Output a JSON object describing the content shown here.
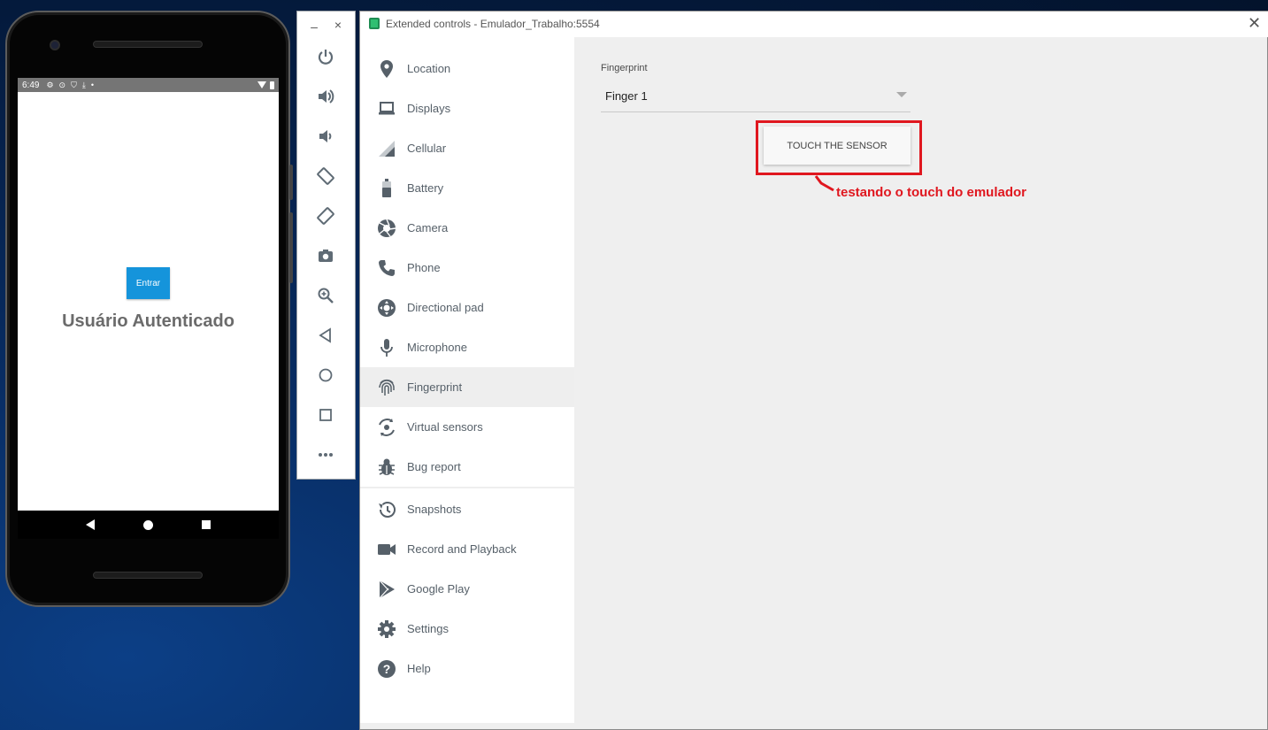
{
  "phone": {
    "status": {
      "time": "6:49",
      "icons": [
        "settings-icon",
        "location-icon",
        "shield-icon",
        "download-icon",
        "dot-icon"
      ],
      "right_icons": [
        "wifi-icon",
        "battery-icon"
      ]
    },
    "button_label": "Entrar",
    "auth_text": "Usuário Autenticado",
    "nav": [
      "back",
      "home",
      "recents"
    ]
  },
  "toolbar": {
    "minimize": "–",
    "close": "×",
    "buttons": [
      "power",
      "volume-up",
      "volume-down",
      "rotate-left",
      "rotate-right",
      "screenshot",
      "zoom",
      "back",
      "home",
      "overview",
      "more"
    ]
  },
  "window": {
    "title": "Extended controls - Emulador_Trabalho:5554",
    "close": "✕"
  },
  "sidebar": {
    "items": [
      {
        "label": "Location",
        "icon": "location-icon"
      },
      {
        "label": "Displays",
        "icon": "displays-icon"
      },
      {
        "label": "Cellular",
        "icon": "cellular-icon"
      },
      {
        "label": "Battery",
        "icon": "battery-icon"
      },
      {
        "label": "Camera",
        "icon": "camera-icon"
      },
      {
        "label": "Phone",
        "icon": "phone-icon"
      },
      {
        "label": "Directional pad",
        "icon": "dpad-icon"
      },
      {
        "label": "Microphone",
        "icon": "microphone-icon"
      },
      {
        "label": "Fingerprint",
        "icon": "fingerprint-icon",
        "active": true
      },
      {
        "label": "Virtual sensors",
        "icon": "virtual-sensors-icon"
      },
      {
        "label": "Bug report",
        "icon": "bug-icon"
      },
      {
        "label": "Snapshots",
        "icon": "snapshots-icon"
      },
      {
        "label": "Record and Playback",
        "icon": "record-icon"
      },
      {
        "label": "Google Play",
        "icon": "play-icon"
      },
      {
        "label": "Settings",
        "icon": "settings-icon"
      },
      {
        "label": "Help",
        "icon": "help-icon"
      }
    ]
  },
  "content": {
    "fingerprint_label": "Fingerprint",
    "finger_selected": "Finger 1",
    "touch_button": "TOUCH THE SENSOR",
    "annotation": "testando o touch do emulador"
  },
  "colors": {
    "accent": "#1594db",
    "annotation_red": "#e0171f",
    "icon_gray": "#566069"
  }
}
